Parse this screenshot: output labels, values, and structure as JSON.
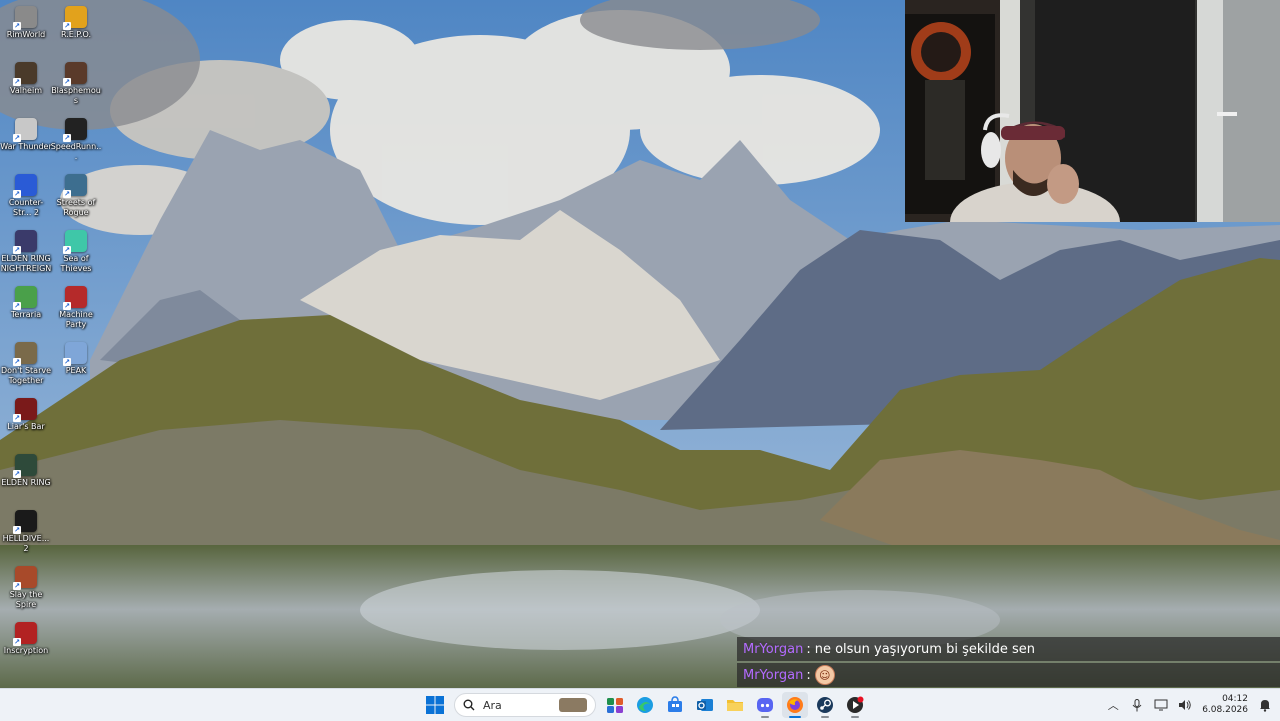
{
  "desktop": {
    "icons": [
      {
        "label": "RimWorld",
        "icon": "rimworld-icon",
        "color": "#8a8a8a"
      },
      {
        "label": "R.E.P.O.",
        "icon": "repo-icon",
        "color": "#e2a21c"
      },
      {
        "label": "Valheim",
        "icon": "valheim-icon",
        "color": "#4a3a2a"
      },
      {
        "label": "Blasphemous",
        "icon": "blasphemous-icon",
        "color": "#5a3a2a"
      },
      {
        "label": "War Thunder",
        "icon": "war-thunder-icon",
        "color": "#c8c8c8"
      },
      {
        "label": "SpeedRunn...",
        "icon": "speedrunners-icon",
        "color": "#222222"
      },
      {
        "label": "Counter-Str... 2",
        "icon": "counter-strike-icon",
        "color": "#2a5bd6"
      },
      {
        "label": "Streets of Rogue",
        "icon": "streets-of-rogue-icon",
        "color": "#3d6e8f"
      },
      {
        "label": "ELDEN RING NIGHTREIGN",
        "icon": "elden-ring-nightreign-icon",
        "color": "#3a3a6a"
      },
      {
        "label": "Sea of Thieves",
        "icon": "sea-of-thieves-icon",
        "color": "#3fc7a8"
      },
      {
        "label": "Terraria",
        "icon": "terraria-icon",
        "color": "#4aa04a"
      },
      {
        "label": "Machine Party",
        "icon": "machine-party-icon",
        "color": "#b52a2a"
      },
      {
        "label": "Don't Starve Together",
        "icon": "dont-starve-together-icon",
        "color": "#7a6a4a"
      },
      {
        "label": "PEAK",
        "icon": "peak-icon",
        "color": "#7fa6d8"
      },
      {
        "label": "Liar's Bar",
        "icon": "liars-bar-icon",
        "color": "#7a1a1a"
      },
      {
        "label": "ELDEN RING",
        "icon": "elden-ring-icon",
        "color": "#2e4a3a"
      },
      {
        "label": "HELLDIVE... 2",
        "icon": "helldivers-icon",
        "color": "#1a1a1a"
      },
      {
        "label": "Slay the Spire",
        "icon": "slay-the-spire-icon",
        "color": "#a84a2a"
      },
      {
        "label": "Inscryption",
        "icon": "inscryption-icon",
        "color": "#b22222"
      }
    ]
  },
  "chat": {
    "messages": [
      {
        "user": "MrYorgan",
        "separator": ":",
        "text": "ne olsun yaşıyorum bi şekilde sen"
      },
      {
        "user": "MrYorgan",
        "separator": ":",
        "text": ""
      }
    ],
    "user_color": "#b36bff"
  },
  "taskbar": {
    "search_placeholder": "Ara",
    "apps": [
      {
        "name": "start-icon"
      },
      {
        "name": "widgets-icon"
      },
      {
        "name": "edge-icon"
      },
      {
        "name": "store-icon"
      },
      {
        "name": "outlook-icon"
      },
      {
        "name": "file-explorer-icon"
      },
      {
        "name": "discord-icon"
      },
      {
        "name": "firefox-icon"
      },
      {
        "name": "steam-icon"
      },
      {
        "name": "media-app-icon"
      }
    ],
    "time": "04:12",
    "date": "6.08.2026"
  }
}
